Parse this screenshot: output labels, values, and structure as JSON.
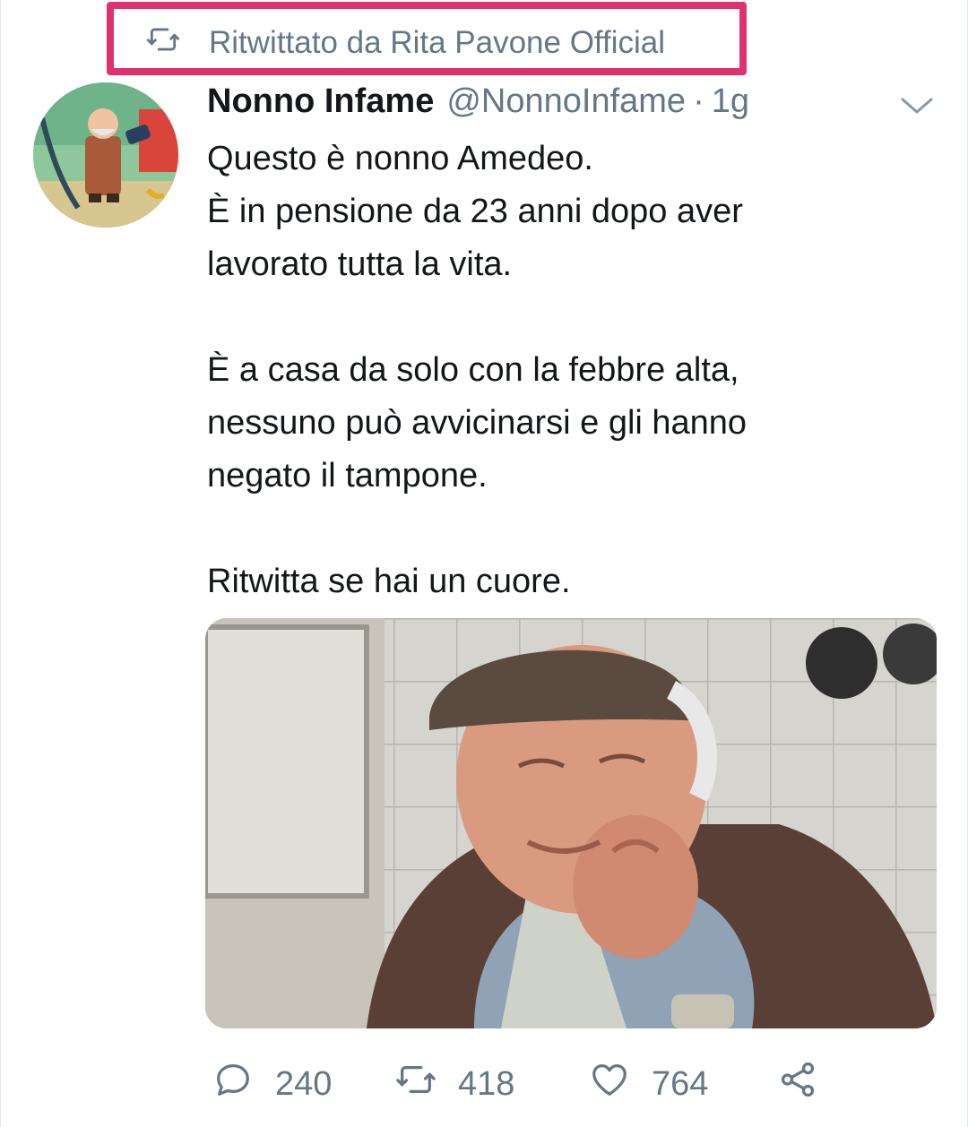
{
  "retweet_banner": {
    "icon": "retweet-icon",
    "text": "Ritwittato da Rita Pavone Official"
  },
  "tweet": {
    "avatar_icon": "avatar-image",
    "display_name": "Nonno Infame",
    "handle": "@NonnoInfame",
    "separator": "·",
    "time": "1g",
    "menu_icon": "chevron-down-icon",
    "text_lines": [
      "Questo è nonno Amedeo.",
      "È in pensione da 23 anni dopo aver",
      "lavorato tutta la vita.",
      "",
      "È a casa da solo con la febbre alta,",
      "nessuno può avvicinarsi e gli hanno",
      "negato il tampone.",
      "",
      "Ritwitta se hai un cuore."
    ]
  },
  "actions": {
    "reply": {
      "icon": "reply-icon",
      "count": "240"
    },
    "retweet": {
      "icon": "retweet-icon",
      "count": "418"
    },
    "like": {
      "icon": "heart-icon",
      "count": "764"
    },
    "share": {
      "icon": "share-icon"
    }
  },
  "colors": {
    "highlight": "#e0306e",
    "muted": "#657786",
    "text": "#14171a"
  }
}
